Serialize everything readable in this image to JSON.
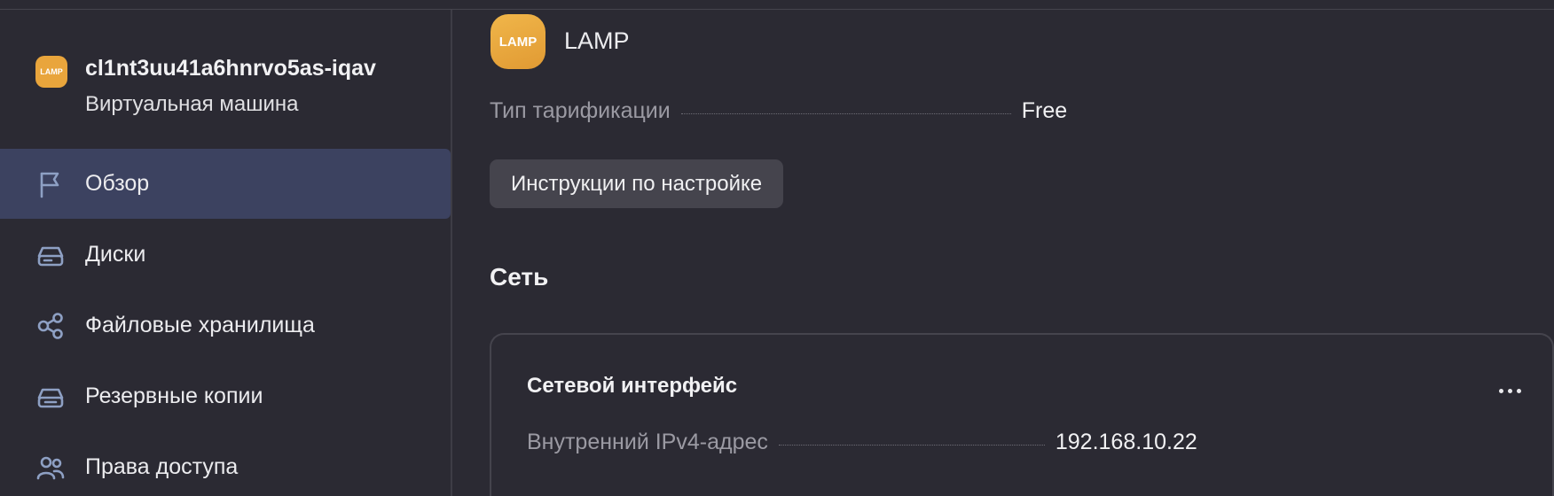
{
  "sidebar": {
    "vm": {
      "logo_text": "LAMP",
      "name": "cl1nt3uu41a6hnrvo5as-iqav",
      "type": "Виртуальная машина"
    },
    "items": [
      {
        "label": "Обзор",
        "icon": "flag-icon",
        "active": true
      },
      {
        "label": "Диски",
        "icon": "disk-icon"
      },
      {
        "label": "Файловые хранилища",
        "icon": "share-nodes-icon"
      },
      {
        "label": "Резервные копии",
        "icon": "backup-icon"
      },
      {
        "label": "Права доступа",
        "icon": "users-icon"
      }
    ]
  },
  "main": {
    "app_logo_text": "LAMP",
    "app_title": "LAMP",
    "billing": {
      "key": "Тип тарификации",
      "value": "Free"
    },
    "instructions_button": "Инструкции по настройке",
    "network_title": "Сеть",
    "network_card": {
      "title": "Сетевой интерфейс",
      "ip": {
        "key": "Внутренний IPv4-адрес",
        "value": "192.168.10.22"
      }
    }
  },
  "colors": {
    "background": "#2b2a33",
    "active_nav": "#3c4260",
    "logo": "#e9a53c",
    "icon": "#8ea0c4"
  }
}
